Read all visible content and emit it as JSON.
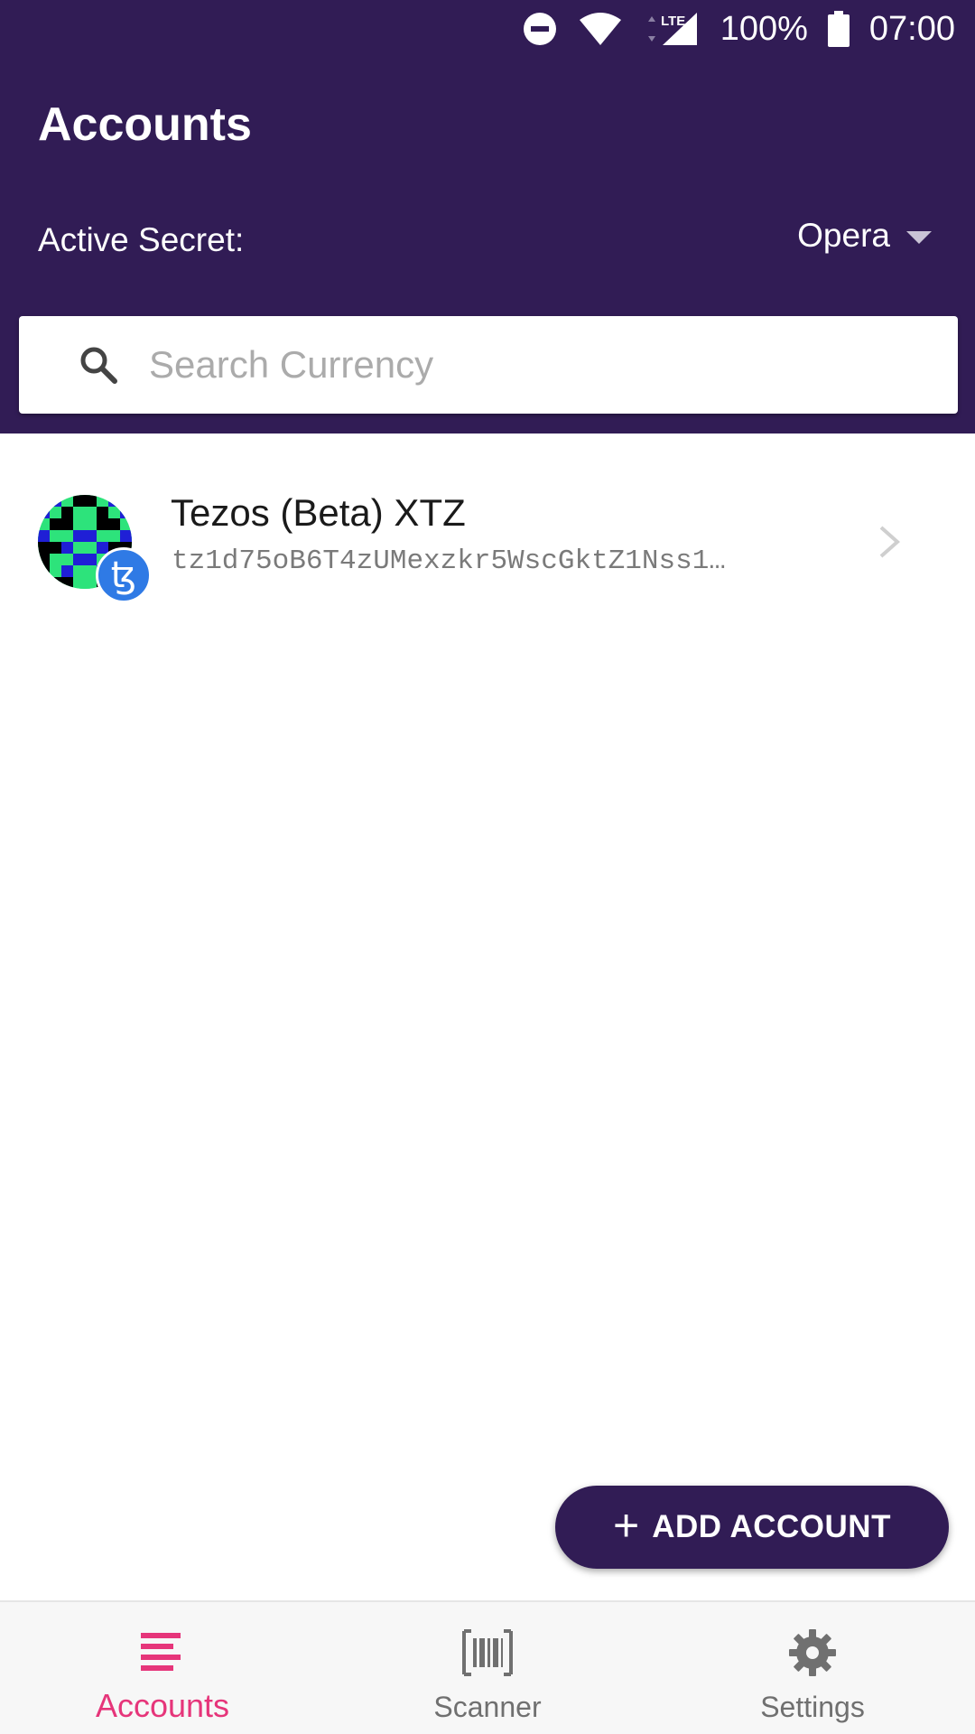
{
  "status_bar": {
    "battery": "100%",
    "time": "07:00",
    "network": "LTE",
    "icons": [
      "do-not-disturb-icon",
      "wifi-icon",
      "signal-icon",
      "battery-icon"
    ]
  },
  "header": {
    "title": "Accounts",
    "active_secret_label": "Active Secret:",
    "active_secret_value": "Opera",
    "background": "#311c55"
  },
  "search": {
    "placeholder": "Search Currency",
    "value": ""
  },
  "accounts": [
    {
      "name": "Tezos (Beta) XTZ",
      "address": "tz1d75oB6T4zUMexzkr5WscGktZ1Nss1…",
      "coin_icon": "tezos-icon",
      "badge_color": "#2f7ae5"
    }
  ],
  "fab": {
    "label": "ADD ACCOUNT",
    "icon": "plus-icon"
  },
  "bottom_nav": {
    "items": [
      {
        "label": "Accounts",
        "icon": "list-icon",
        "active": true
      },
      {
        "label": "Scanner",
        "icon": "barcode-icon",
        "active": false
      },
      {
        "label": "Settings",
        "icon": "gear-icon",
        "active": false
      }
    ],
    "active_color": "#e6357a"
  }
}
